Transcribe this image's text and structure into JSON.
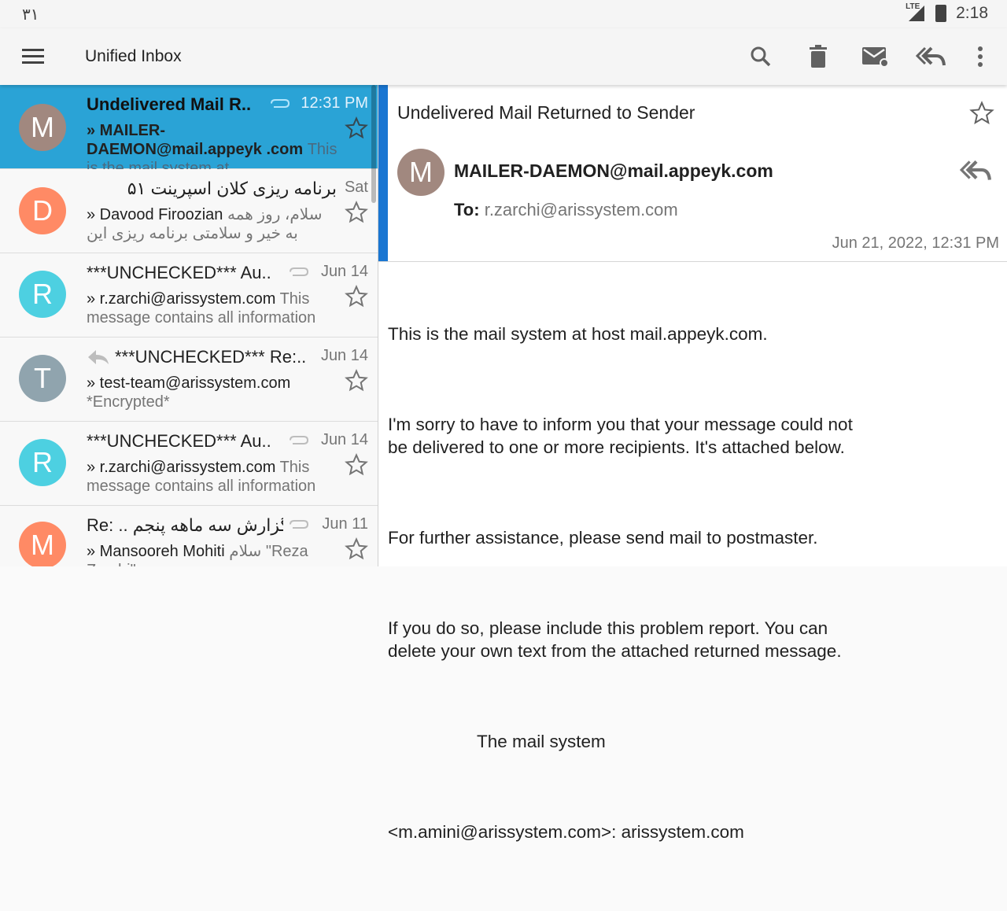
{
  "status": {
    "left_text": "۳۱",
    "network": "LTE",
    "time": "2:18"
  },
  "appbar": {
    "title": "Unified Inbox"
  },
  "toolbar": {
    "icons": [
      "search-icon",
      "delete-icon",
      "mark-unread-icon",
      "reply-all-icon",
      "overflow-menu-icon"
    ]
  },
  "messages": [
    {
      "avatar": "M",
      "avatar_color": "#a1887f",
      "subject": "Undelivered Mail R..",
      "date": "12:31 PM",
      "attachment": true,
      "sender": "» MAILER-DAEMON@mail.appeyk .com",
      "snippet": "This is the mail system at",
      "selected": true
    },
    {
      "avatar": "D",
      "avatar_color": "#ff8a65",
      "subject": "برنامه ریزی کلان اسپرینت ۵۱",
      "date": "Sat",
      "attachment": false,
      "sender": "» Davood Firoozian",
      "snippet": "سلام، روز همه به خیر و سلامتی برنامه ریزی این اسپرینت",
      "selected": false
    },
    {
      "avatar": "R",
      "avatar_color": "#4dd0e1",
      "subject": "***UNCHECKED*** Au..",
      "date": "Jun 14",
      "attachment": true,
      "sender": "» r.zarchi@arissystem.com",
      "snippet": "This message contains all information",
      "selected": false
    },
    {
      "avatar": "T",
      "avatar_color": "#90a4ae",
      "subject": "***UNCHECKED*** Re:..",
      "date": "Jun 14",
      "attachment": false,
      "replied": true,
      "sender": "» test-team@arissystem.com",
      "snippet": "*Encrypted*",
      "selected": false
    },
    {
      "avatar": "R",
      "avatar_color": "#4dd0e1",
      "subject": "***UNCHECKED*** Au..",
      "date": "Jun 14",
      "attachment": true,
      "sender": "» r.zarchi@arissystem.com",
      "snippet": "This message contains all information",
      "selected": false
    },
    {
      "avatar": "M",
      "avatar_color": "#ff8a65",
      "subject": "Re: .. گزارش سه ماهه پنجم",
      "date": "Jun 11",
      "attachment": true,
      "sender": "» Mansooreh Mohiti",
      "snippet": "سلام \"Reza Zarchi\"",
      "selected": false
    }
  ],
  "reader": {
    "subject": "Undelivered Mail Returned to Sender",
    "avatar": "M",
    "from": "MAILER-DAEMON@mail.appeyk.com",
    "to_label": "To:",
    "to": "r.zarchi@arissystem.com",
    "date": "Jun 21, 2022, 12:31 PM",
    "body": {
      "p1": "This is the mail system at host mail.appeyk.com.",
      "p2": "I'm sorry to have to inform you that your message could not\nbe delivered to one or more recipients. It's attached below.",
      "p3": "For further assistance, please send mail to postmaster.",
      "p4": "If you do so, please include this problem report. You can\ndelete your own text from the attached returned message.",
      "p5": "The mail system",
      "p6": "<m.amini@arissystem.com>: arissystem.com"
    }
  }
}
